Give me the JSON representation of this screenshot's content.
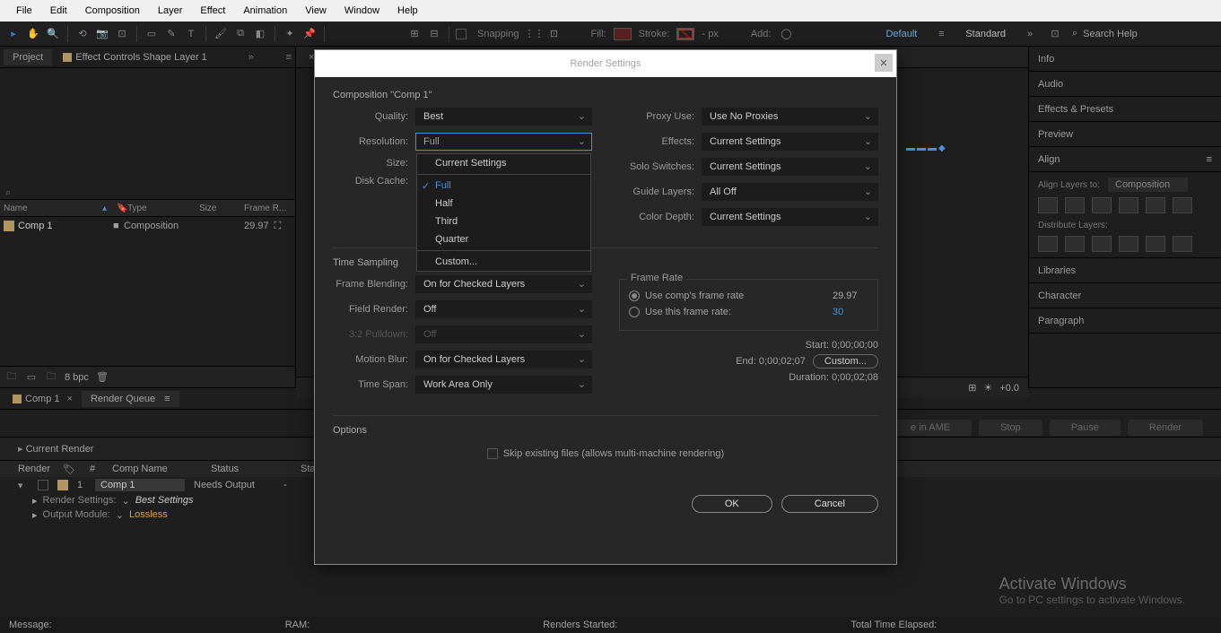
{
  "menu": {
    "items": [
      "File",
      "Edit",
      "Composition",
      "Layer",
      "Effect",
      "Animation",
      "View",
      "Window",
      "Help"
    ]
  },
  "toolbar": {
    "snapping": "Snapping",
    "fill": "Fill:",
    "stroke": "Stroke:",
    "stroke_w": "- px",
    "add": "Add:",
    "ws_default": "Default",
    "ws_standard": "Standard",
    "search_ph": "Search Help"
  },
  "project_panel": {
    "tab_project": "Project",
    "tab_effects": "Effect Controls Shape Layer 1",
    "cols": {
      "name": "Name",
      "type": "Type",
      "size": "Size",
      "frame": "Frame R..."
    },
    "row": {
      "name": "Comp 1",
      "type": "Composition",
      "fps": "29.97"
    },
    "bpc": "8 bpc"
  },
  "comp_panel": {
    "tab": "×"
  },
  "right_panels": {
    "info": "Info",
    "audio": "Audio",
    "ep": "Effects & Presets",
    "preview": "Preview",
    "align": "Align",
    "align_to": "Align Layers to:",
    "align_to_val": "Composition",
    "dist": "Distribute Layers:",
    "libraries": "Libraries",
    "character": "Character",
    "paragraph": "Paragraph"
  },
  "render_queue": {
    "tab_comp": "Comp 1",
    "tab_rq": "Render Queue",
    "current": "Current Render",
    "cols": {
      "render": "Render",
      "eye": "",
      "num": "#",
      "comp": "Comp Name",
      "status": "Status",
      "started": "Starte..."
    },
    "row": {
      "num": "1",
      "name": "Comp 1",
      "status": "Needs Output",
      "started": "-"
    },
    "rs_label": "Render Settings:",
    "rs_val": "Best Settings",
    "om_label": "Output Module:",
    "om_val": "Lossless",
    "btn_ame": "e in AME",
    "btn_stop": "Stop",
    "btn_pause": "Pause",
    "btn_render": "Render"
  },
  "dialog": {
    "title": "Render Settings",
    "comp_label": "Composition \"Comp 1\"",
    "quality_l": "Quality:",
    "quality_v": "Best",
    "resolution_l": "Resolution:",
    "resolution_v": "Full",
    "resolution_opts": [
      "Current Settings",
      "Full",
      "Half",
      "Third",
      "Quarter",
      "Custom..."
    ],
    "size_l": "Size:",
    "disk_l": "Disk Cache:",
    "proxy_l": "Proxy Use:",
    "proxy_v": "Use No Proxies",
    "effects_l": "Effects:",
    "effects_v": "Current Settings",
    "solo_l": "Solo Switches:",
    "solo_v": "Current Settings",
    "guide_l": "Guide Layers:",
    "guide_v": "All Off",
    "depth_l": "Color Depth:",
    "depth_v": "Current Settings",
    "ts_title": "Time Sampling",
    "fb_l": "Frame Blending:",
    "fb_v": "On for Checked Layers",
    "fr_l": "Field Render:",
    "fr_v": "Off",
    "pd_l": "3:2 Pulldown:",
    "pd_v": "Off",
    "mb_l": "Motion Blur:",
    "mb_v": "On for Checked Layers",
    "span_l": "Time Span:",
    "span_v": "Work Area Only",
    "fr_title": "Frame Rate",
    "fr_comp": "Use comp's frame rate",
    "fr_comp_v": "29.97",
    "fr_this": "Use this frame rate:",
    "fr_this_v": "30",
    "start_l": "Start:",
    "start_v": "0;00;00;00",
    "end_l": "End:",
    "end_v": "0;00;02;07",
    "dur_l": "Duration:",
    "dur_v": "0;00;02;08",
    "custom_btn": "Custom...",
    "opt_title": "Options",
    "skip": "Skip existing files (allows multi-machine rendering)",
    "ok": "OK",
    "cancel": "Cancel"
  },
  "viewer_footer": {
    "zoom": "+0.0"
  },
  "statusbar": {
    "msg": "Message:",
    "ram": "RAM:",
    "renders": "Renders Started:",
    "total": "Total Time Elapsed:"
  },
  "watermark": {
    "big": "Activate Windows",
    "small": "Go to PC settings to activate Windows."
  }
}
